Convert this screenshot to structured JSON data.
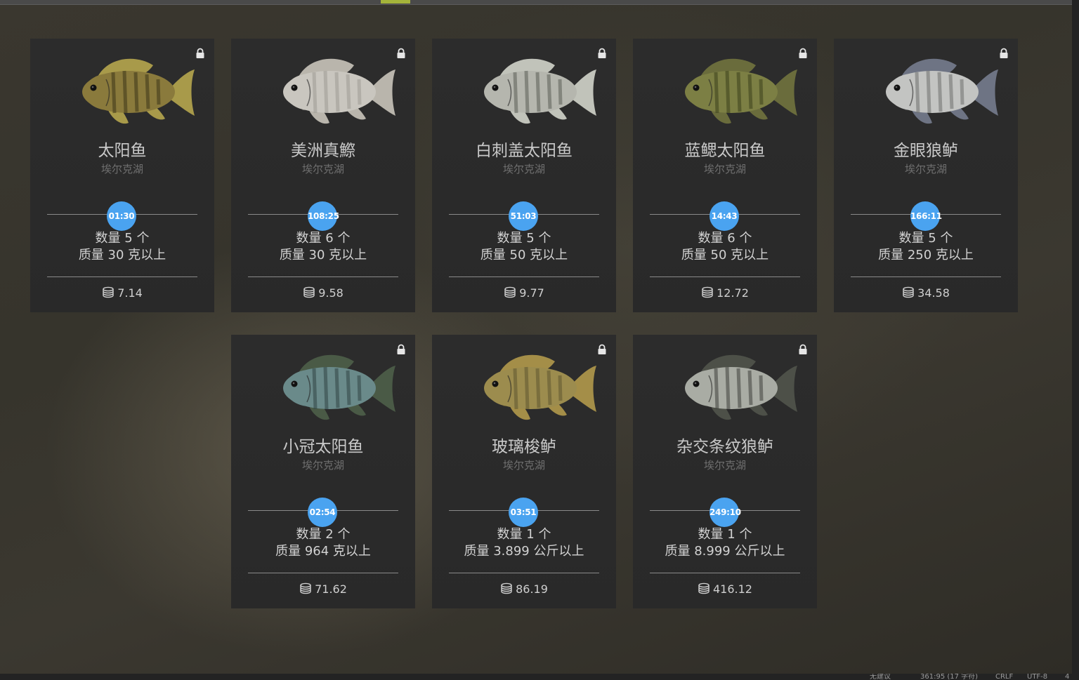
{
  "status_bar": {
    "suggestion": "无建议",
    "position": "361:95 (17 字符)",
    "line_ending": "CRLF",
    "encoding": "UTF-8",
    "extra": "4"
  },
  "fish_cards": [
    {
      "name": "太阳鱼",
      "location": "埃尔克湖",
      "timer": "01:30",
      "quantity": "数量 5 个",
      "weight": "质量 30 克以上",
      "reward": "7.14",
      "body_color": "#8a7a3c",
      "stripe_color": "#3c3418",
      "fin_color": "#a89a4a",
      "locked": true
    },
    {
      "name": "美洲真鰶",
      "location": "埃尔克湖",
      "timer": "108:25",
      "quantity": "数量 6 个",
      "weight": "质量 30 克以上",
      "reward": "9.58",
      "body_color": "#c9c6bf",
      "stripe_color": "#9d9a93",
      "fin_color": "#b9b5ac",
      "locked": true
    },
    {
      "name": "白刺盖太阳鱼",
      "location": "埃尔克湖",
      "timer": "51:03",
      "quantity": "数量 5 个",
      "weight": "质量 50 克以上",
      "reward": "9.77",
      "body_color": "#b5b6ae",
      "stripe_color": "#5a5c55",
      "fin_color": "#c1c3ba",
      "locked": true
    },
    {
      "name": "蓝鳃太阳鱼",
      "location": "埃尔克湖",
      "timer": "14:43",
      "quantity": "数量 6 个",
      "weight": "质量 50 克以上",
      "reward": "12.72",
      "body_color": "#7c7f44",
      "stripe_color": "#3b3f1c",
      "fin_color": "#6a6c3c",
      "locked": true
    },
    {
      "name": "金眼狼鲈",
      "location": "埃尔克湖",
      "timer": "166:11",
      "quantity": "数量 5 个",
      "weight": "质量 250 克以上",
      "reward": "34.58",
      "body_color": "#c3c4c2",
      "stripe_color": "#6e706e",
      "fin_color": "#6e7484",
      "locked": true
    },
    {
      "name": "小冠太阳鱼",
      "location": "埃尔克湖",
      "timer": "02:54",
      "quantity": "数量 2 个",
      "weight": "质量 964 克以上",
      "reward": "71.62",
      "body_color": "#6a8a8a",
      "stripe_color": "#2f4444",
      "fin_color": "#4a5a46",
      "locked": true
    },
    {
      "name": "玻璃梭鲈",
      "location": "埃尔克湖",
      "timer": "03:51",
      "quantity": "数量 1 个",
      "weight": "质量 3.899 公斤以上",
      "reward": "86.19",
      "body_color": "#9c8c4e",
      "stripe_color": "#5f5630",
      "fin_color": "#a48e48",
      "locked": true
    },
    {
      "name": "杂交条纹狼鲈",
      "location": "埃尔克湖",
      "timer": "249:10",
      "quantity": "数量 1 个",
      "weight": "质量 8.999 公斤以上",
      "reward": "416.12",
      "body_color": "#a9aca4",
      "stripe_color": "#3e403a",
      "fin_color": "#4d5048",
      "locked": true
    }
  ]
}
